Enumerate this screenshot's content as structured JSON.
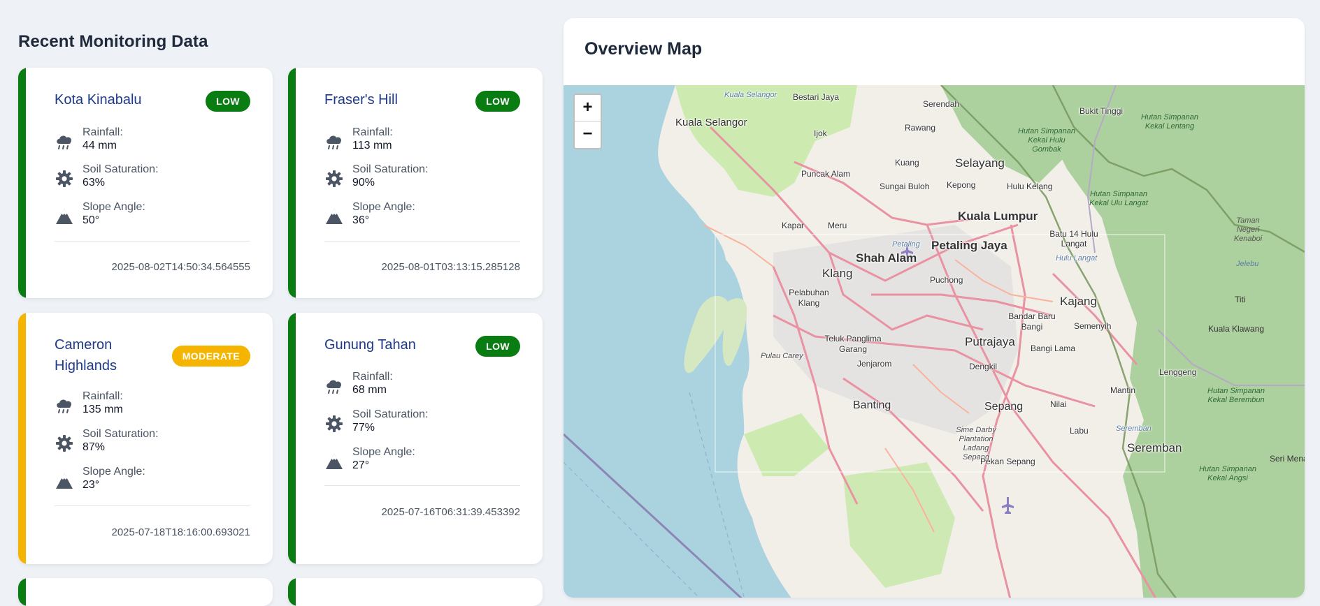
{
  "section": {
    "title": "Recent Monitoring Data"
  },
  "labels": {
    "rainfall": "Rainfall:",
    "soil": "Soil Saturation:",
    "slope": "Slope Angle:"
  },
  "colors": {
    "low": "#0a7d12",
    "moderate": "#f4b400"
  },
  "cards": [
    {
      "name": "Kota Kinabalu",
      "risk": "LOW",
      "rainfall": "44 mm",
      "soil": "63%",
      "slope": "50°",
      "timestamp": "2025-08-02T14:50:34.564555"
    },
    {
      "name": "Fraser's Hill",
      "risk": "LOW",
      "rainfall": "113 mm",
      "soil": "90%",
      "slope": "36°",
      "timestamp": "2025-08-01T03:13:15.285128"
    },
    {
      "name": "Cameron Highlands",
      "risk": "MODERATE",
      "rainfall": "135 mm",
      "soil": "87%",
      "slope": "23°",
      "timestamp": "2025-07-18T18:16:00.693021"
    },
    {
      "name": "Gunung Tahan",
      "risk": "LOW",
      "rainfall": "68 mm",
      "soil": "77%",
      "slope": "27°",
      "timestamp": "2025-07-16T06:31:39.453392"
    }
  ],
  "map": {
    "title": "Overview Map",
    "zoom_in": "+",
    "zoom_out": "−",
    "labels": {
      "kuala_selangor_river": "Kuala Selangor",
      "bestari_jaya": "Bestari Jaya",
      "serendah": "Serendah",
      "bukit_tinggi": "Bukit Tinggi",
      "hs_kekal_lentang": "Hutan Simpanan Kekal Lentang",
      "kuala_selangor": "Kuala Selangor",
      "rawang": "Rawang",
      "ijok": "Ijok",
      "hs_kekal_hulu_gombak": "Hutan Simpanan Kekal Hulu Gombak",
      "kuang": "Kuang",
      "selayang": "Selayang",
      "puncak_alam": "Puncak Alam",
      "sungai_buloh": "Sungai Buloh",
      "kepong": "Kepong",
      "hulu_kelang": "Hulu Kelang",
      "hs_kekal_ulu_langat": "Hutan Simpanan Kekal Ulu Langat",
      "taman_negeri_kenaboi": "Taman Negeri Kenaboi",
      "kapar": "Kapar",
      "meru": "Meru",
      "kuala_lumpur": "Kuala Lumpur",
      "batu_14_hulu_langat": "Batu 14 Hulu Langat",
      "petaling_river": "Petaling",
      "petaling_jaya": "Petaling Jaya",
      "hulu_langat_river": "Hulu Langat",
      "jelebu": "Jelebu",
      "shah_alam": "Shah Alam",
      "klang": "Klang",
      "puchong": "Puchong",
      "pelabuhan_klang": "Pelabuhan Klang",
      "kajang": "Kajang",
      "titi": "Titi",
      "bandar_baru_bangi": "Bandar Baru Bangi",
      "semenyih": "Semenyih",
      "kuala_klawang": "Kuala Klawang",
      "teluk_panglima_garang": "Teluk Panglima Garang",
      "putrajaya": "Putrajaya",
      "bangi_lama": "Bangi Lama",
      "pulau_carey": "Pulau Carey",
      "jenjarom": "Jenjarom",
      "dengkil": "Dengkil",
      "lenggeng": "Lenggeng",
      "mantin": "Mantin",
      "hs_kekal_berembun": "Hutan Simpanan Kekal Berembun",
      "banting": "Banting",
      "sepang": "Sepang",
      "nilai": "Nilai",
      "sime_darby": "Sime Darby Plantation Ladang Sepang",
      "labu": "Labu",
      "seremban_river": "Seremban",
      "seremban": "Seremban",
      "seri_menanti": "Seri Mena",
      "pekan_sepang": "Pekan Sepang",
      "hs_kekal_angsi": "Hutan Simpanan Kekal Angsi"
    }
  }
}
